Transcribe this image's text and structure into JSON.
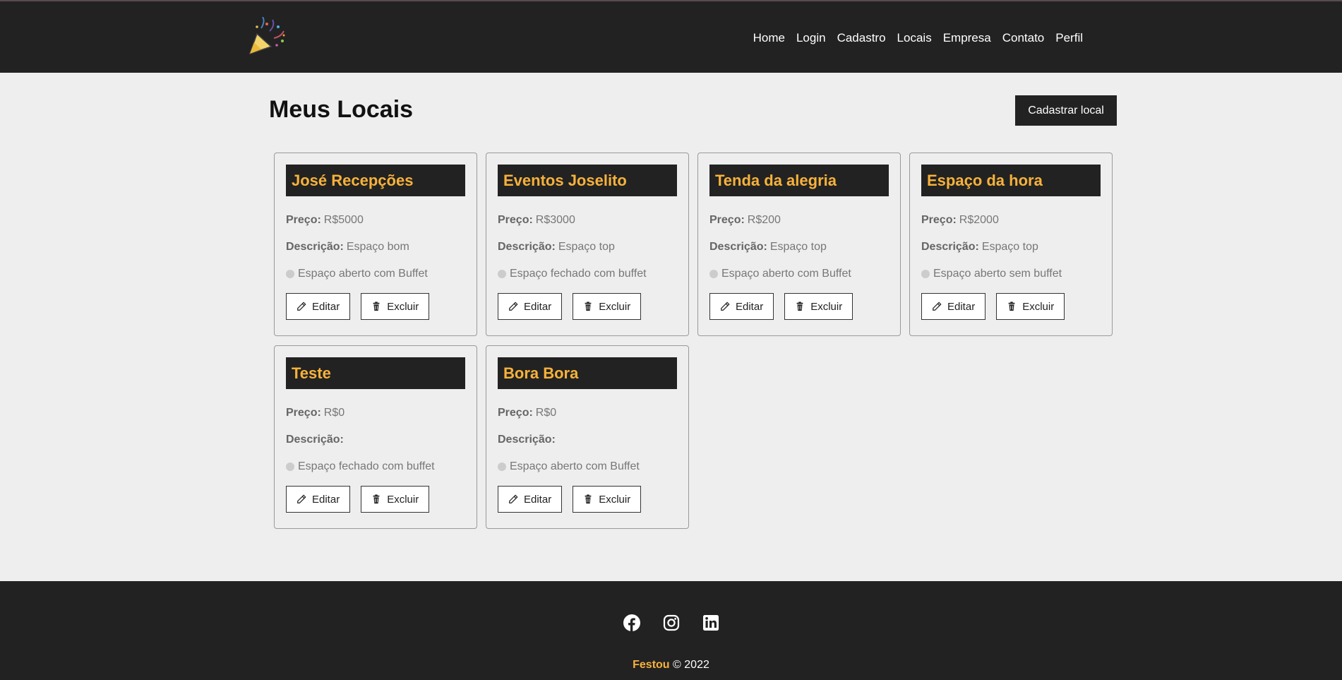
{
  "nav": [
    "Home",
    "Login",
    "Cadastro",
    "Locais",
    "Empresa",
    "Contato",
    "Perfil"
  ],
  "page": {
    "title": "Meus Locais",
    "new_button": "Cadastrar local"
  },
  "labels": {
    "price": "Preço:",
    "description": "Descrição:",
    "edit": "Editar",
    "delete": "Excluir"
  },
  "venues": [
    {
      "name": "José Recepções",
      "price": "R$5000",
      "description": "Espaço bom",
      "type": "Espaço aberto com Buffet"
    },
    {
      "name": "Eventos Joselito",
      "price": "R$3000",
      "description": "Espaço top",
      "type": "Espaço fechado com buffet"
    },
    {
      "name": "Tenda da alegria",
      "price": "R$200",
      "description": "Espaço top",
      "type": "Espaço aberto com Buffet"
    },
    {
      "name": "Espaço da hora",
      "price": "R$2000",
      "description": "Espaço top",
      "type": "Espaço aberto sem buffet"
    },
    {
      "name": "Teste",
      "price": "R$0",
      "description": "",
      "type": "Espaço fechado com buffet"
    },
    {
      "name": "Bora Bora",
      "price": "R$0",
      "description": "",
      "type": "Espaço aberto com Buffet"
    }
  ],
  "footer": {
    "brand": "Festou",
    "copyright": "© 2022",
    "social_icons": [
      "facebook-icon",
      "instagram-icon",
      "linkedin-icon"
    ]
  },
  "colors": {
    "header_bg": "#222222",
    "accent": "#f7b23b",
    "page_bg": "#eeeeee"
  }
}
